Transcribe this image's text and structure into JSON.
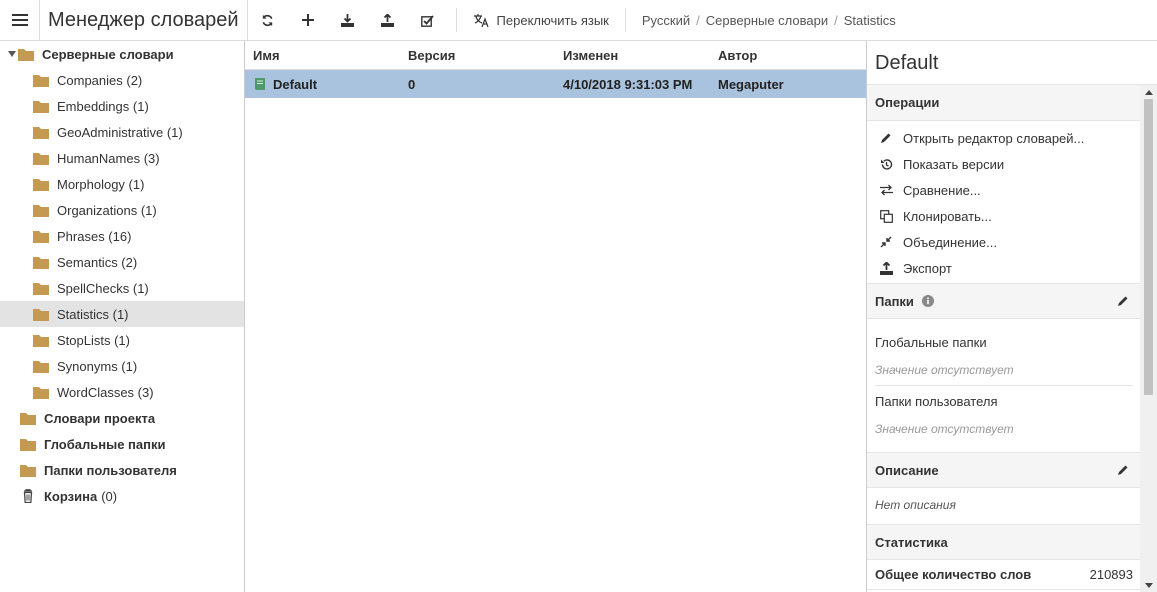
{
  "app": {
    "title": "Менеджер словарей"
  },
  "toolbar": {
    "icons": [
      "menu-icon",
      "refresh-icon",
      "add-icon",
      "download-icon",
      "upload-icon",
      "check-icon",
      "translate-icon"
    ],
    "switch_language_label": "Переключить язык"
  },
  "breadcrumb": [
    "Русский",
    "Серверные словари",
    "Statistics"
  ],
  "tree": {
    "root": "Серверные словари",
    "children": [
      "Companies (2)",
      "Embeddings (1)",
      "GeoAdministrative (1)",
      "HumanNames (3)",
      "Morphology (1)",
      "Organizations (1)",
      "Phrases (16)",
      "Semantics (2)",
      "SpellChecks (1)",
      "Statistics (1)",
      "StopLists (1)",
      "Synonyms (1)",
      "WordClasses (3)"
    ],
    "selected": "Statistics (1)",
    "project": "Словари проекта",
    "global": "Глобальные папки",
    "user": "Папки пользователя",
    "trash_label": "Корзина",
    "trash_count": "(0)"
  },
  "grid": {
    "columns": [
      "Имя",
      "Версия",
      "Изменен",
      "Автор"
    ],
    "rows": [
      {
        "name": "Default",
        "version": "0",
        "modified": "4/10/2018 9:31:03 PM",
        "author": "Megaputer"
      }
    ]
  },
  "details": {
    "title": "Default",
    "operations_header": "Операции",
    "operations": [
      "Открыть редактор словарей...",
      "Показать версии",
      "Сравнение...",
      "Клонировать...",
      "Объединение...",
      "Экспорт"
    ],
    "folders_header": "Папки",
    "global_folders_label": "Глобальные папки",
    "global_folders_value": "Значение отсутствует",
    "user_folders_label": "Папки пользователя",
    "user_folders_value": "Значение отсутствует",
    "description_header": "Описание",
    "description_value": "Нет описания",
    "statistics_header": "Статистика",
    "total_words_label": "Общее количество слов",
    "total_words_value": "210893"
  },
  "colors": {
    "selected_row": "#a9c3de",
    "folder": "#c49a52",
    "tree_selected": "#e3e3e3"
  }
}
